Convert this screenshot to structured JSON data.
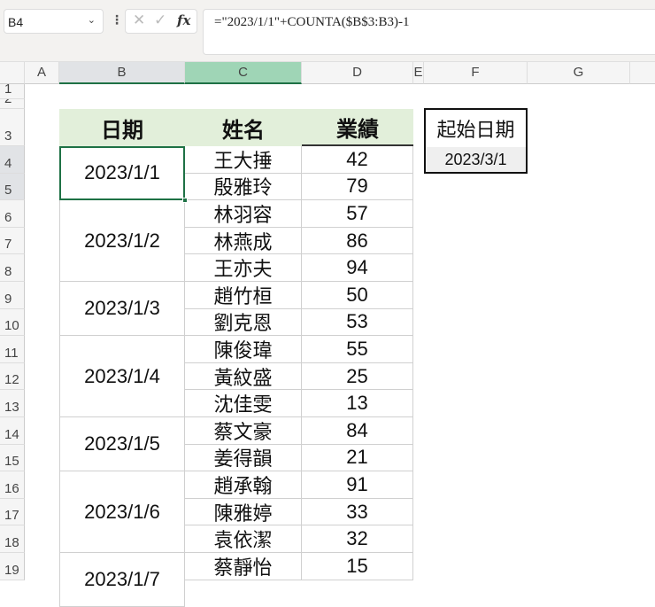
{
  "formula_bar": {
    "name_box": "B4",
    "formula": "=\"2023/1/1\"+COUNTA($B$3:B3)-1",
    "cancel_icon": "✕",
    "confirm_icon": "✓",
    "fx_label": "fx"
  },
  "columns": [
    "A",
    "B",
    "C",
    "D",
    "E",
    "F",
    "G"
  ],
  "rows": [
    "1",
    "2",
    "3",
    "4",
    "5",
    "6",
    "7",
    "8",
    "9",
    "10",
    "11",
    "12",
    "13",
    "14",
    "15",
    "16",
    "17",
    "18",
    "19"
  ],
  "table": {
    "headers": {
      "date": "日期",
      "name": "姓名",
      "score": "業績"
    },
    "date_groups": [
      {
        "date": "2023/1/1",
        "span": 2
      },
      {
        "date": "2023/1/2",
        "span": 3
      },
      {
        "date": "2023/1/3",
        "span": 2
      },
      {
        "date": "2023/1/4",
        "span": 3
      },
      {
        "date": "2023/1/5",
        "span": 2
      },
      {
        "date": "2023/1/6",
        "span": 3
      },
      {
        "date": "2023/1/7",
        "span": 2
      }
    ],
    "records": [
      {
        "name": "王大捶",
        "score": "42"
      },
      {
        "name": "殷雅玲",
        "score": "79"
      },
      {
        "name": "林羽容",
        "score": "57"
      },
      {
        "name": "林燕成",
        "score": "86"
      },
      {
        "name": "王亦夫",
        "score": "94"
      },
      {
        "name": "趙竹桓",
        "score": "50"
      },
      {
        "name": "劉克恩",
        "score": "53"
      },
      {
        "name": "陳俊瑋",
        "score": "55"
      },
      {
        "name": "黃紋盛",
        "score": "25"
      },
      {
        "name": "沈佳雯",
        "score": "13"
      },
      {
        "name": "蔡文豪",
        "score": "84"
      },
      {
        "name": "姜得韻",
        "score": "21"
      },
      {
        "name": "趙承翰",
        "score": "91"
      },
      {
        "name": "陳雅婷",
        "score": "33"
      },
      {
        "name": "袁依潔",
        "score": "32"
      },
      {
        "name": "蔡靜怡",
        "score": "15"
      }
    ]
  },
  "start_box": {
    "label": "起始日期",
    "value": "2023/3/1"
  }
}
